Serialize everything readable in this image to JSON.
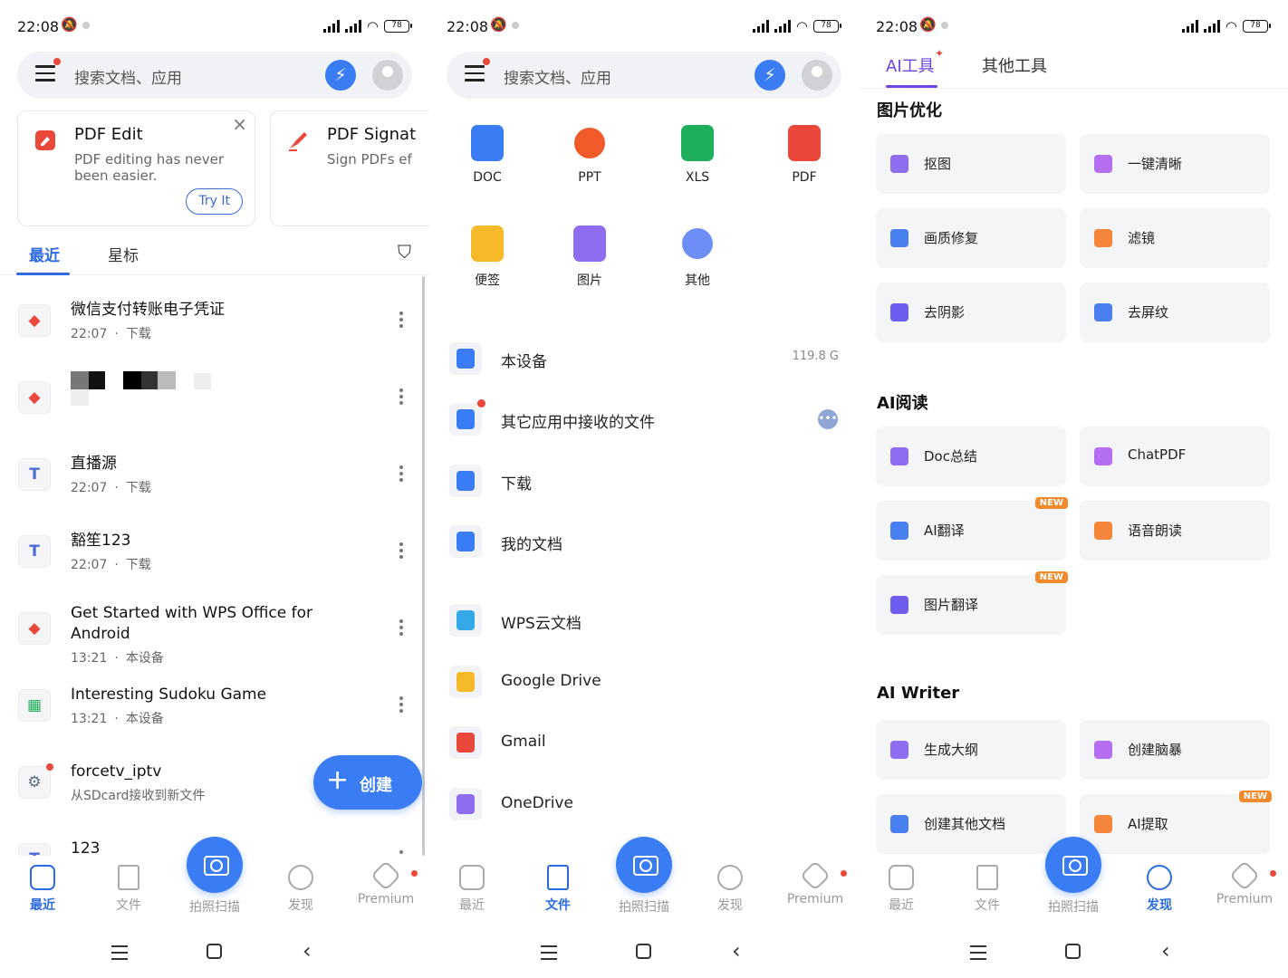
{
  "status": {
    "time": "22:08",
    "battery": "78"
  },
  "search": {
    "placeholder": "搜索文档、应用"
  },
  "promo": [
    {
      "title": "PDF Edit",
      "desc": "PDF editing has never been easier.",
      "button": "Try It"
    },
    {
      "title": "PDF Signat",
      "desc": "Sign PDFs ef"
    }
  ],
  "tabs": {
    "recent": "最近",
    "starred": "星标"
  },
  "recent_files": [
    {
      "name": "微信支付转账电子凭证",
      "time": "22:07",
      "source": "下载",
      "type": "pdf"
    },
    {
      "name": "",
      "time": "",
      "source": "",
      "type": "pdf"
    },
    {
      "name": "直播源",
      "time": "22:07",
      "source": "下载",
      "type": "txt"
    },
    {
      "name": "豁笙123",
      "time": "22:07",
      "source": "下载",
      "type": "txt"
    },
    {
      "name": "Get Started with WPS Office for Android",
      "time": "13:21",
      "source": "本设备",
      "type": "pdf"
    },
    {
      "name": "Interesting Sudoku Game",
      "time": "13:21",
      "source": "本设备",
      "type": "xls"
    },
    {
      "name": "forcetv_iptv",
      "time": "",
      "source": "从SDcard接收到新文件",
      "type": "other"
    },
    {
      "name": "123",
      "time": "",
      "source": "",
      "type": "txt"
    }
  ],
  "meta_sep": "·",
  "fab": {
    "label": "创建"
  },
  "bottom_nav": {
    "recent": "最近",
    "files": "文件",
    "scan": "拍照扫描",
    "discover": "发现",
    "premium": "Premium"
  },
  "file_types": [
    "DOC",
    "PPT",
    "XLS",
    "PDF",
    "便签",
    "图片",
    "其他"
  ],
  "locations": [
    {
      "label": "本设备",
      "right": "119.8 G"
    },
    {
      "label": "其它应用中接收的文件"
    },
    {
      "label": "下载"
    },
    {
      "label": "我的文档"
    },
    {
      "label": "WPS云文档"
    },
    {
      "label": "Google Drive"
    },
    {
      "label": "Gmail"
    },
    {
      "label": "OneDrive"
    }
  ],
  "tools_tabs": {
    "ai": "AI工具",
    "other": "其他工具"
  },
  "tool_sections": {
    "image": "图片优化",
    "read": "AI阅读",
    "writer": "AI Writer"
  },
  "tools": {
    "image": [
      "抠图",
      "一键清晰",
      "画质修复",
      "滤镜",
      "去阴影",
      "去屏纹"
    ],
    "read": [
      "Doc总结",
      "ChatPDF",
      "AI翻译",
      "语音朗读",
      "图片翻译"
    ],
    "writer": [
      "生成大纲",
      "创建脑暴",
      "创建其他文档",
      "AI提取"
    ]
  },
  "new_badge": "NEW",
  "colors": {
    "accent": "#2d6be0",
    "ai": "#6b46e0",
    "pdf": "#e9483b",
    "xls": "#1fae5b",
    "doc": "#3a7cf4",
    "ppt": "#f05a28"
  }
}
